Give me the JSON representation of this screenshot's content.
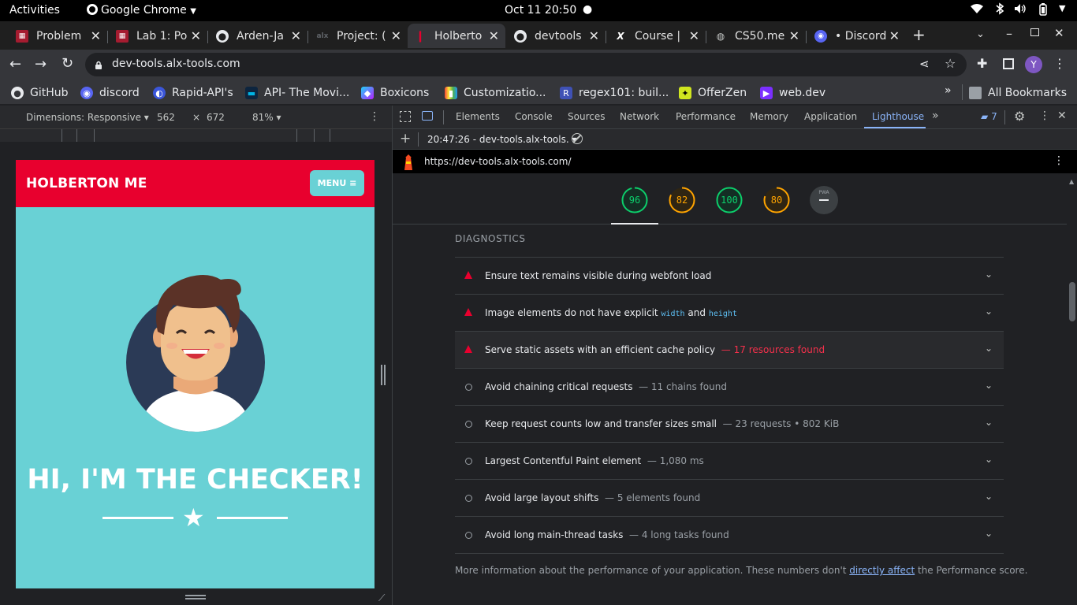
{
  "system_bar": {
    "activities": "Activities",
    "app": "Google Chrome",
    "datetime": "Oct 11  20:50"
  },
  "tabs": [
    {
      "title": "Problem",
      "favicon": "harvard-icon"
    },
    {
      "title": "Lab 1: Po",
      "favicon": "harvard-icon"
    },
    {
      "title": "Arden-Ja",
      "favicon": "github-icon"
    },
    {
      "title": "Project: (",
      "favicon": "alx-icon"
    },
    {
      "title": "Holberto",
      "favicon": "holberton-icon"
    },
    {
      "title": "devtools",
      "favicon": "github-icon"
    },
    {
      "title": "Course |",
      "favicon": "x-icon"
    },
    {
      "title": "CS50.me",
      "favicon": "globe-icon"
    },
    {
      "title": "• Discord",
      "favicon": "discord-icon"
    }
  ],
  "omnibox": {
    "url": "dev-tools.alx-tools.com",
    "avatar": "Y"
  },
  "bookmarks": [
    {
      "label": "GitHub",
      "icon": "github-icon",
      "color": "#ffffff"
    },
    {
      "label": "discord",
      "icon": "discord-icon",
      "color": "#5865f2"
    },
    {
      "label": "Rapid-API's",
      "icon": "rapidapi-icon",
      "color": "#3b56d9"
    },
    {
      "label": "API- The Movi...",
      "icon": "tmdb-icon",
      "color": "#0d253f"
    },
    {
      "label": "Boxicons",
      "icon": "boxicons-icon",
      "color": "#9b59f5"
    },
    {
      "label": "Customizatio...",
      "icon": "customization-icon",
      "color": "#e8a317"
    },
    {
      "label": "regex101: buil...",
      "icon": "regex-icon",
      "color": "#3f51b5"
    },
    {
      "label": "OfferZen",
      "icon": "offerzen-icon",
      "color": "#d0e61f"
    },
    {
      "label": "web.dev",
      "icon": "webdev-icon",
      "color": "#7b2fff"
    }
  ],
  "all_bookmarks": "All Bookmarks",
  "device_toolbar": {
    "dimensions": "Dimensions: Responsive ▾",
    "width": "562",
    "times": "×",
    "height": "672",
    "zoom": "81% ▾"
  },
  "emulated_page": {
    "brand": "HOLBERTON ME",
    "menu": "MENU ≡",
    "hero": "HI, I'M THE CHECKER!"
  },
  "devtools": {
    "tabs": [
      "Elements",
      "Console",
      "Sources",
      "Network",
      "Performance",
      "Memory",
      "Application",
      "Lighthouse"
    ],
    "active_tab": "Lighthouse",
    "issues_count": "7",
    "report_label": "20:47:26 - dev-tools.alx-tools. ▾",
    "report_url": "https://dev-tools.alx-tools.com/"
  },
  "scores": [
    {
      "value": "96",
      "color": "#0cce6b",
      "fill": 0.96
    },
    {
      "value": "82",
      "color": "#ffa400",
      "fill": 0.82
    },
    {
      "value": "100",
      "color": "#0cce6b",
      "fill": 1.0
    },
    {
      "value": "80",
      "color": "#ffa400",
      "fill": 0.8
    }
  ],
  "pwa_label": "PWA",
  "diagnostics_title": "DIAGNOSTICS",
  "audits": [
    {
      "status": "fail",
      "title": "Ensure text remains visible during webfont load",
      "detail": ""
    },
    {
      "status": "fail",
      "title": "Image elements do not have explicit",
      "code1": "width",
      "and": "and",
      "code2": "height",
      "detail": ""
    },
    {
      "status": "fail",
      "title": "Serve static assets with an efficient cache policy",
      "detail": "— 17 resources found"
    },
    {
      "status": "info",
      "title": "Avoid chaining critical requests",
      "detail": "— 11 chains found"
    },
    {
      "status": "info",
      "title": "Keep request counts low and transfer sizes small",
      "detail": "— 23 requests • 802 KiB"
    },
    {
      "status": "info",
      "title": "Largest Contentful Paint element",
      "detail": "— 1,080 ms"
    },
    {
      "status": "info",
      "title": "Avoid large layout shifts",
      "detail": "— 5 elements found"
    },
    {
      "status": "info",
      "title": "Avoid long main-thread tasks",
      "detail": "— 4 long tasks found"
    }
  ],
  "perf_note": {
    "before": "More information about the performance of your application. These numbers don't ",
    "link": "directly affect",
    "after": " the Performance score."
  }
}
